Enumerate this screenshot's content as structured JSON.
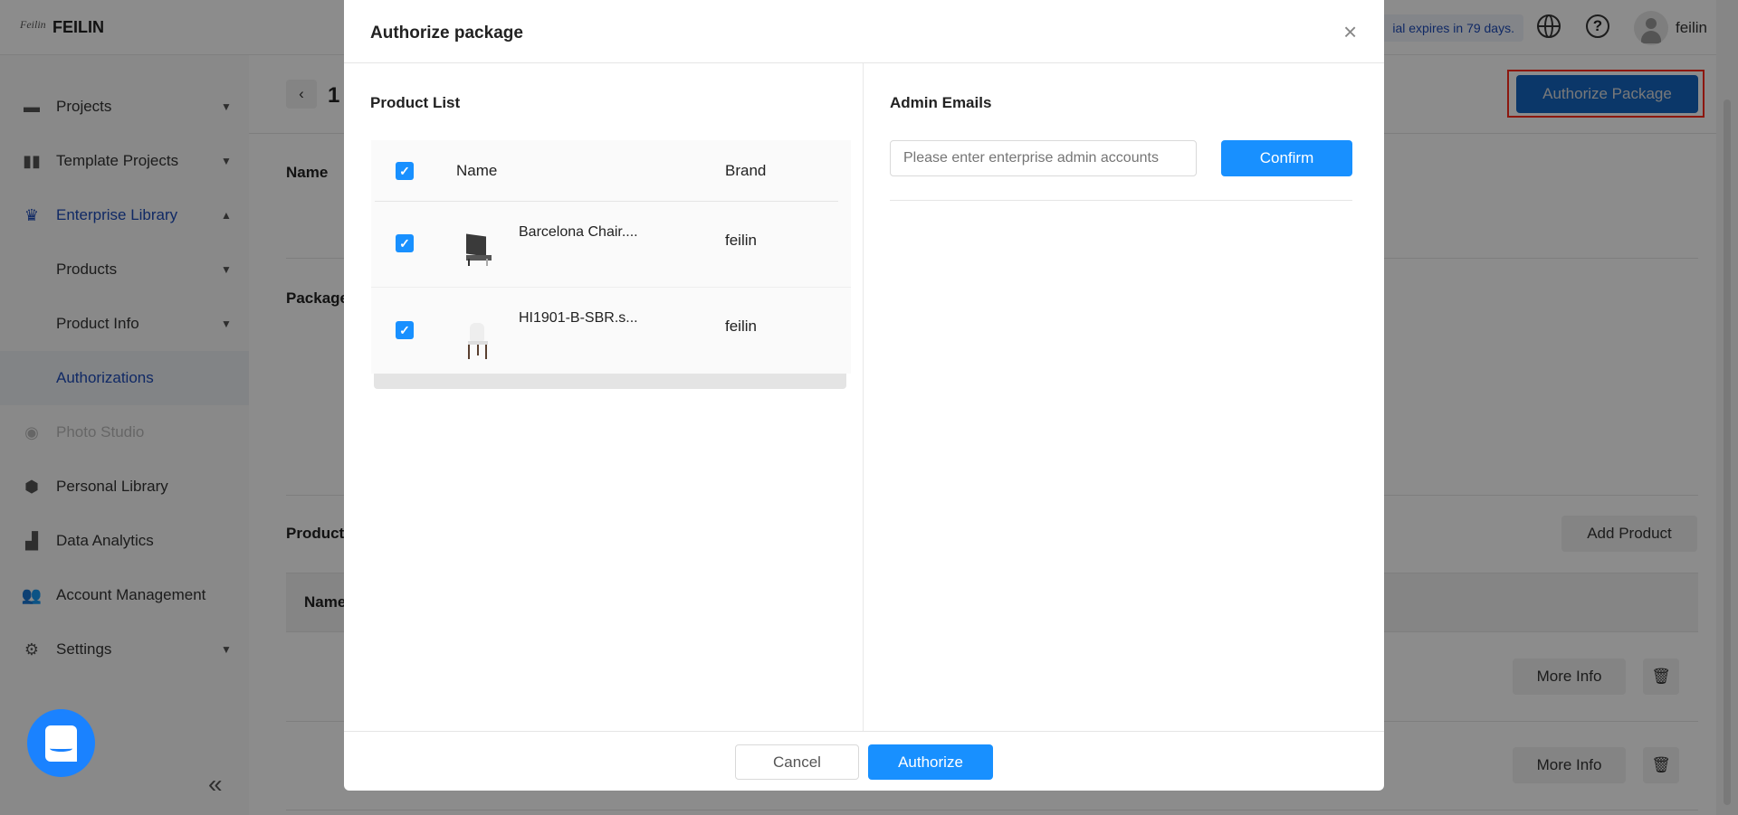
{
  "header": {
    "brand": "FEILIN",
    "logo_text": "Feilin",
    "trial_notice": "ial expires in 79 days.",
    "username": "feilin"
  },
  "sidebar": {
    "items": [
      {
        "label": "Projects",
        "icon": "folder-icon"
      },
      {
        "label": "Template Projects",
        "icon": "template-icon"
      },
      {
        "label": "Enterprise Library",
        "icon": "crown-icon"
      },
      {
        "label": "Products"
      },
      {
        "label": "Product Info"
      },
      {
        "label": "Authorizations"
      },
      {
        "label": "Photo Studio",
        "icon": "camera-icon"
      },
      {
        "label": "Personal Library",
        "icon": "cube-icon"
      },
      {
        "label": "Data Analytics",
        "icon": "bar-chart-icon"
      },
      {
        "label": "Account Management",
        "icon": "users-icon"
      },
      {
        "label": "Settings",
        "icon": "gear-icon"
      }
    ],
    "collapse": "«"
  },
  "page": {
    "title": "1",
    "authorize_package": "Authorize Package",
    "name_label": "Name",
    "package_label": "Package",
    "product_label": "Product",
    "add_product": "Add Product",
    "table_name_header": "Name",
    "more_info": "More Info"
  },
  "modal": {
    "title": "Authorize package",
    "product_list_title": "Product List",
    "columns": {
      "name": "Name",
      "brand": "Brand"
    },
    "rows": [
      {
        "name": "Barcelona Chair....",
        "brand": "feilin",
        "checked": true
      },
      {
        "name": "HI1901-B-SBR.s...",
        "brand": "feilin",
        "checked": true
      }
    ],
    "admin_emails_title": "Admin Emails",
    "email_placeholder": "Please enter enterprise admin accounts",
    "confirm": "Confirm",
    "cancel": "Cancel",
    "authorize": "Authorize"
  },
  "colors": {
    "primary": "#1890ff",
    "accent_blue": "#1e4bb8",
    "highlight": "#ff2a1a"
  }
}
